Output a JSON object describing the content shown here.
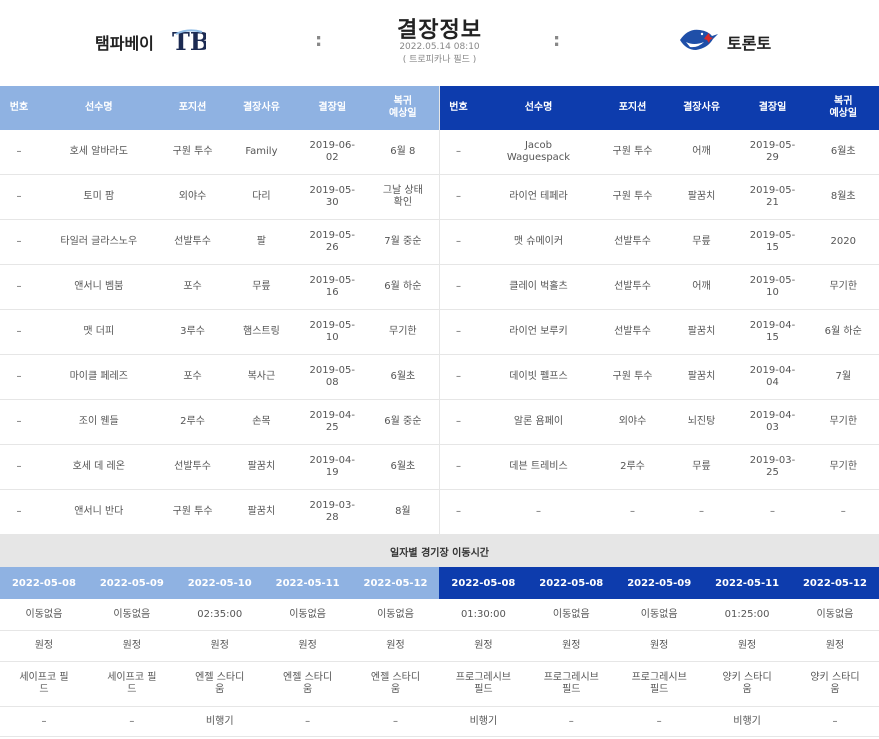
{
  "header": {
    "title": "결장정보",
    "date": "2022.05.14 08:10",
    "venue": "( 트로피카나 필드 )",
    "separator": ":",
    "home_team": "탬파베이",
    "away_team": "토론토",
    "home_logo_text": "TB"
  },
  "columns": [
    "번호",
    "선수명",
    "포지션",
    "결장사유",
    "결장일",
    "복귀\n예상일"
  ],
  "home_rows": [
    [
      "–",
      "호세 알바라도",
      "구원 투수",
      "Family",
      "2019-06-\n02",
      "6월 8"
    ],
    [
      "–",
      "토미 팜",
      "외야수",
      "다리",
      "2019-05-\n30",
      "그날 상태\n확인"
    ],
    [
      "–",
      "타일러 글라스노우",
      "선발투수",
      "팔",
      "2019-05-\n26",
      "7월 중순"
    ],
    [
      "–",
      "앤서니 벰붐",
      "포수",
      "무릎",
      "2019-05-\n16",
      "6월 하순"
    ],
    [
      "–",
      "맷 더피",
      "3루수",
      "햄스트링",
      "2019-05-\n10",
      "무기한"
    ],
    [
      "–",
      "마이클 페레즈",
      "포수",
      "복사근",
      "2019-05-\n08",
      "6월초"
    ],
    [
      "–",
      "조이 웬들",
      "2루수",
      "손목",
      "2019-04-\n25",
      "6월 중순"
    ],
    [
      "–",
      "호세 데 레온",
      "선발투수",
      "팔꿈치",
      "2019-04-\n19",
      "6월초"
    ],
    [
      "–",
      "앤서니 반다",
      "구원 투수",
      "팔꿈치",
      "2019-03-\n28",
      "8월"
    ]
  ],
  "away_rows": [
    [
      "–",
      "Jacob\nWaguespack",
      "구원 투수",
      "어깨",
      "2019-05-\n29",
      "6월초"
    ],
    [
      "–",
      "라이언 테페라",
      "구원 투수",
      "팔꿈치",
      "2019-05-\n21",
      "8월초"
    ],
    [
      "–",
      "맷 슈메이커",
      "선발투수",
      "무릎",
      "2019-05-\n15",
      "2020"
    ],
    [
      "–",
      "클레이 벅홀츠",
      "선발투수",
      "어깨",
      "2019-05-\n10",
      "무기한"
    ],
    [
      "–",
      "라이언 보루키",
      "선발투수",
      "팔꿈치",
      "2019-04-\n15",
      "6월 하순"
    ],
    [
      "–",
      "데이빗 펠프스",
      "구원 투수",
      "팔꿈치",
      "2019-04-\n04",
      "7월"
    ],
    [
      "–",
      "알론 욤페이",
      "외야수",
      "뇌진탕",
      "2019-04-\n03",
      "무기한"
    ],
    [
      "–",
      "데븐 트레비스",
      "2루수",
      "무릎",
      "2019-03-\n25",
      "무기한"
    ],
    [
      "–",
      "–",
      "–",
      "–",
      "–",
      "–"
    ]
  ],
  "travel": {
    "title": "일자별 경기장 이동시간",
    "home_dates": [
      "2022-05-08",
      "2022-05-09",
      "2022-05-10",
      "2022-05-11",
      "2022-05-12"
    ],
    "away_dates": [
      "2022-05-08",
      "2022-05-08",
      "2022-05-09",
      "2022-05-11",
      "2022-05-12"
    ],
    "move_time": [
      "이동없음",
      "이동없음",
      "02:35:00",
      "이동없음",
      "이동없음",
      "01:30:00",
      "이동없음",
      "이동없음",
      "01:25:00",
      "이동없음"
    ],
    "home_away": [
      "원정",
      "원정",
      "원정",
      "원정",
      "원정",
      "원정",
      "원정",
      "원정",
      "원정",
      "원정"
    ],
    "stadium": [
      "세이프코 필\n드",
      "세이프코 필\n드",
      "엔젤 스타디\n움",
      "엔젤 스타디\n움",
      "엔젤 스타디\n움",
      "프로그레시브\n필드",
      "프로그레시브\n필드",
      "프로그레시브\n필드",
      "양키 스타디\n움",
      "양키 스타디\n움"
    ],
    "transport": [
      "–",
      "–",
      "비행기",
      "–",
      "–",
      "비행기",
      "–",
      "–",
      "비행기",
      "–"
    ]
  },
  "colors": {
    "home": "#8fb2e2",
    "away": "#0d3cad"
  }
}
